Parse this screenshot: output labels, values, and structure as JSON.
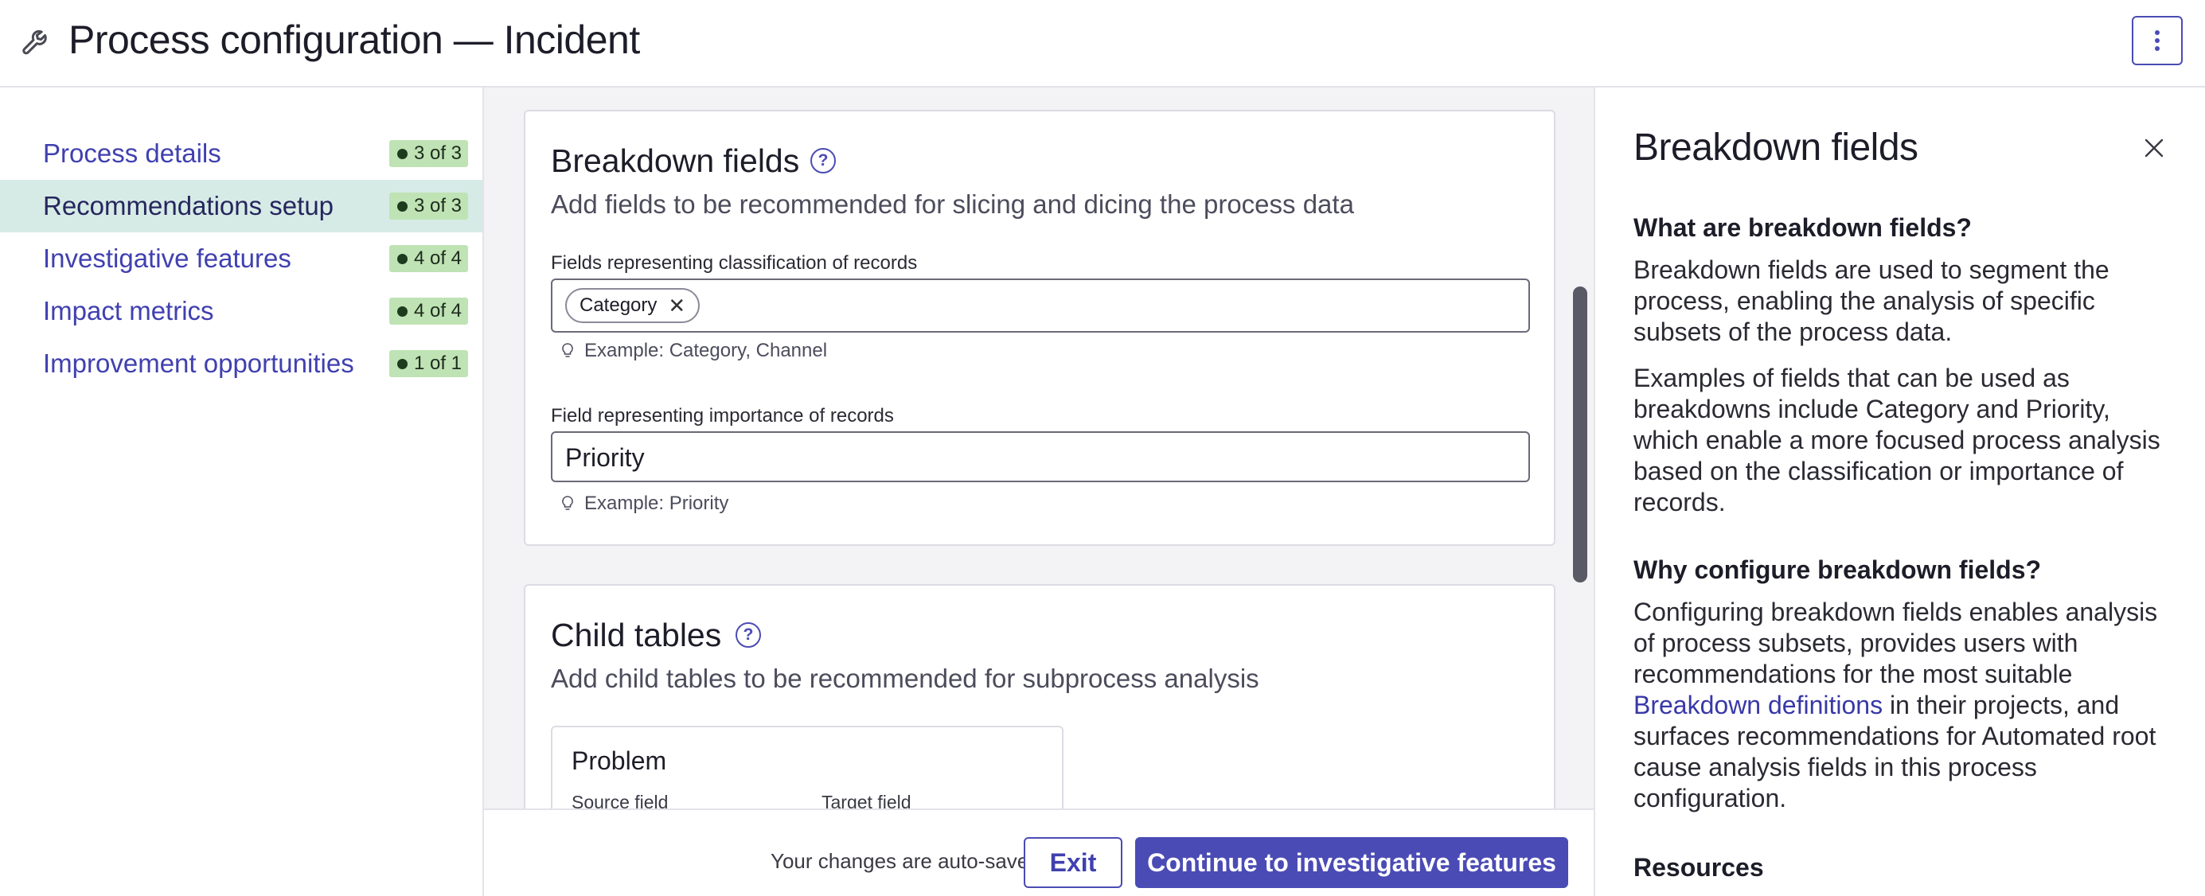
{
  "header": {
    "title": "Process configuration — Incident",
    "wrench_icon": "wrench-icon",
    "more_icon": "vertical-ellipsis-icon"
  },
  "nav": {
    "items": [
      {
        "label": "Process details",
        "badge": "3 of 3",
        "active": false
      },
      {
        "label": "Recommendations setup",
        "badge": "3 of 3",
        "active": true
      },
      {
        "label": "Investigative features",
        "badge": "4 of 4",
        "active": false
      },
      {
        "label": "Impact metrics",
        "badge": "4 of 4",
        "active": false
      },
      {
        "label": "Improvement opportunities",
        "badge": "1 of 1",
        "active": false
      }
    ]
  },
  "breakdown": {
    "title": "Breakdown fields",
    "help_glyph": "?",
    "description": "Add fields to be recommended for slicing and dicing the process data",
    "classification_label": "Fields representing classification of records",
    "classification_chip": "Category",
    "classification_chip_remove": "✕",
    "classification_hint": "Example: Category, Channel",
    "importance_label": "Field representing importance of records",
    "importance_value": "Priority",
    "importance_hint": "Example: Priority"
  },
  "child_tables": {
    "title": "Child tables",
    "help_glyph": "?",
    "description": "Add child tables to be recommended for subprocess analysis",
    "table_name": "Problem",
    "source_field_label": "Source field",
    "target_field_label": "Target field"
  },
  "footer": {
    "autosave": "Your changes are auto-saved",
    "exit_label": "Exit",
    "continue_label": "Continue to investigative features"
  },
  "help_panel": {
    "title": "Breakdown fields",
    "q1": "What are breakdown fields?",
    "p1": "Breakdown fields are used to segment the process, enabling the analysis of specific subsets of the process data.",
    "p2": "Examples of fields that can be used as breakdowns include Category and Priority, which enable a more focused process analysis based on the classification or importance of records.",
    "q2": "Why configure breakdown fields?",
    "p3_before": "Configuring breakdown fields enables analysis of process subsets, provides users with recommendations for the most suitable ",
    "p3_link": "Breakdown definitions",
    "p3_after": " in their projects, and surfaces recommendations for Automated root cause analysis fields in this process configuration.",
    "resources": "Resources"
  },
  "colors": {
    "accent": "#4b4bb5",
    "nav_active_bg": "#d7ebe6",
    "badge_bg": "#bfe3b4",
    "link": "#4040b0"
  }
}
